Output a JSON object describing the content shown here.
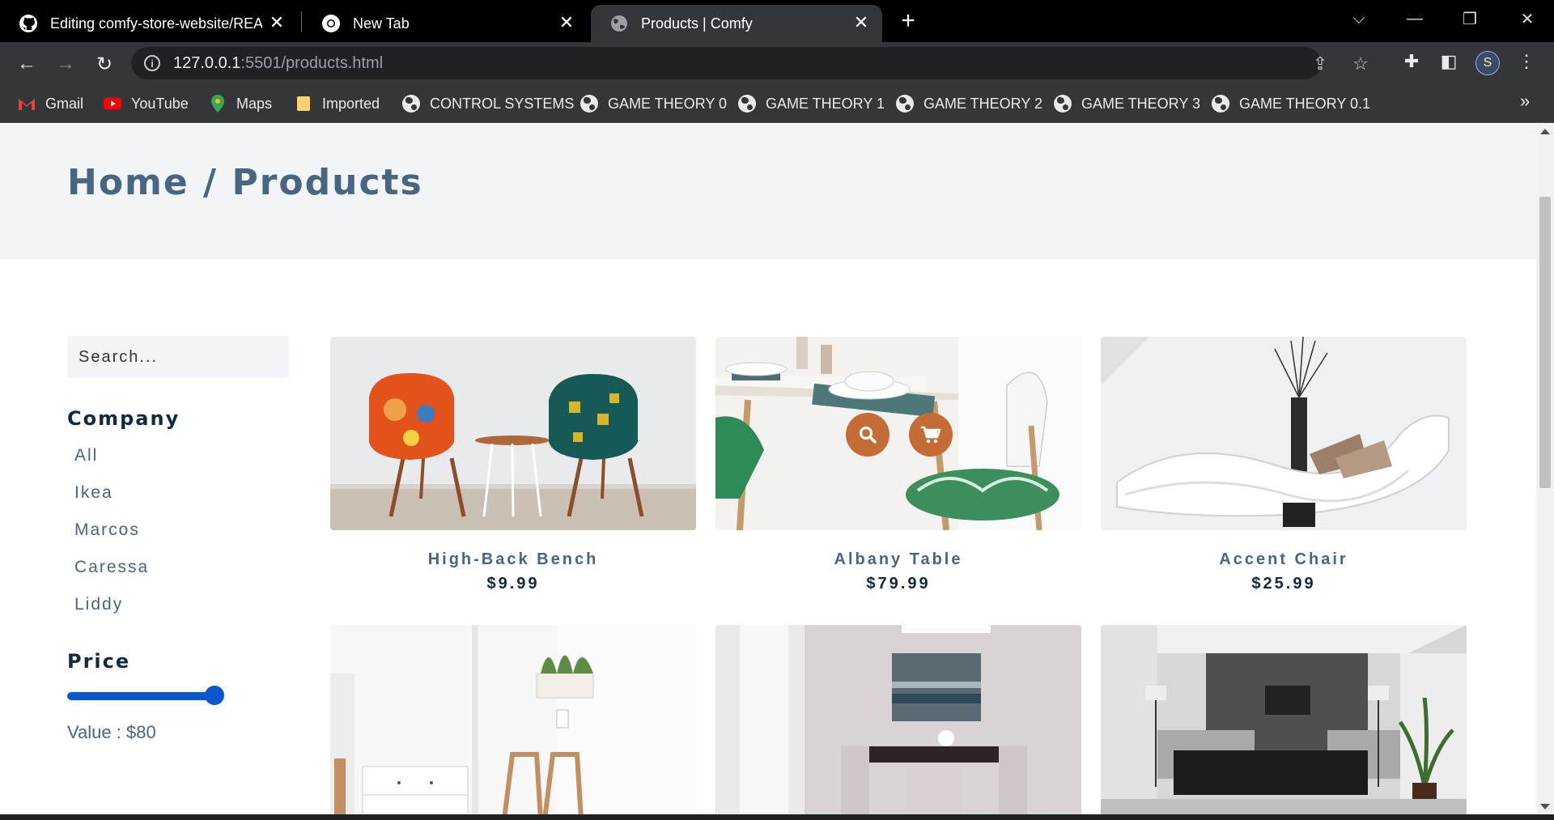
{
  "browser": {
    "tabs": [
      {
        "title": "Editing comfy-store-website/REA",
        "icon": "github-icon",
        "active": false
      },
      {
        "title": "New Tab",
        "icon": "chrome-icon",
        "active": false
      },
      {
        "title": "Products | Comfy",
        "icon": "globe-icon",
        "active": true
      }
    ],
    "address": {
      "host": "127.0.0.1",
      "rest": ":5501/products.html"
    },
    "profile_initial": "S",
    "bookmarks": [
      {
        "label": "Gmail",
        "icon": "gmail-icon"
      },
      {
        "label": "YouTube",
        "icon": "youtube-icon"
      },
      {
        "label": "Maps",
        "icon": "maps-icon"
      },
      {
        "label": "Imported",
        "icon": "folder-icon"
      },
      {
        "label": "CONTROL SYSTEMS",
        "icon": "globe-icon"
      },
      {
        "label": "GAME THEORY 0",
        "icon": "globe-icon"
      },
      {
        "label": "GAME THEORY 1",
        "icon": "globe-icon"
      },
      {
        "label": "GAME THEORY 2",
        "icon": "globe-icon"
      },
      {
        "label": "GAME THEORY 3",
        "icon": "globe-icon"
      },
      {
        "label": "GAME THEORY 0.1",
        "icon": "globe-icon"
      }
    ]
  },
  "page": {
    "hero_title": "Home / Products",
    "search_placeholder": "Search...",
    "company_heading": "Company",
    "companies": [
      "All",
      "Ikea",
      "Marcos",
      "Caressa",
      "Liddy"
    ],
    "price_heading": "Price",
    "price_value_text": "Value : $80",
    "price_slider_fraction": 1.0,
    "products": [
      {
        "name": "High-Back Bench",
        "price": "$9.99",
        "image": "two-patterned-armchairs-with-side-table"
      },
      {
        "name": "Albany Table",
        "price": "$79.99",
        "image": "dining-table-with-white-chair-and-leaf-cushion"
      },
      {
        "name": "Accent Chair",
        "price": "$25.99",
        "image": "white-chaise-lounge-with-pillows"
      },
      {
        "name": "",
        "price": "",
        "image": "bright-room-with-dresser-and-plant-shelf"
      },
      {
        "name": "",
        "price": "",
        "image": "dining-room-with-dark-table-and-painting"
      },
      {
        "name": "",
        "price": "",
        "image": "modern-living-room-with-sofa-and-tv"
      }
    ],
    "colors": {
      "accent": "#c46c34",
      "heading": "#102a42",
      "text": "#486581",
      "hero_bg": "#f1f5f8"
    }
  }
}
